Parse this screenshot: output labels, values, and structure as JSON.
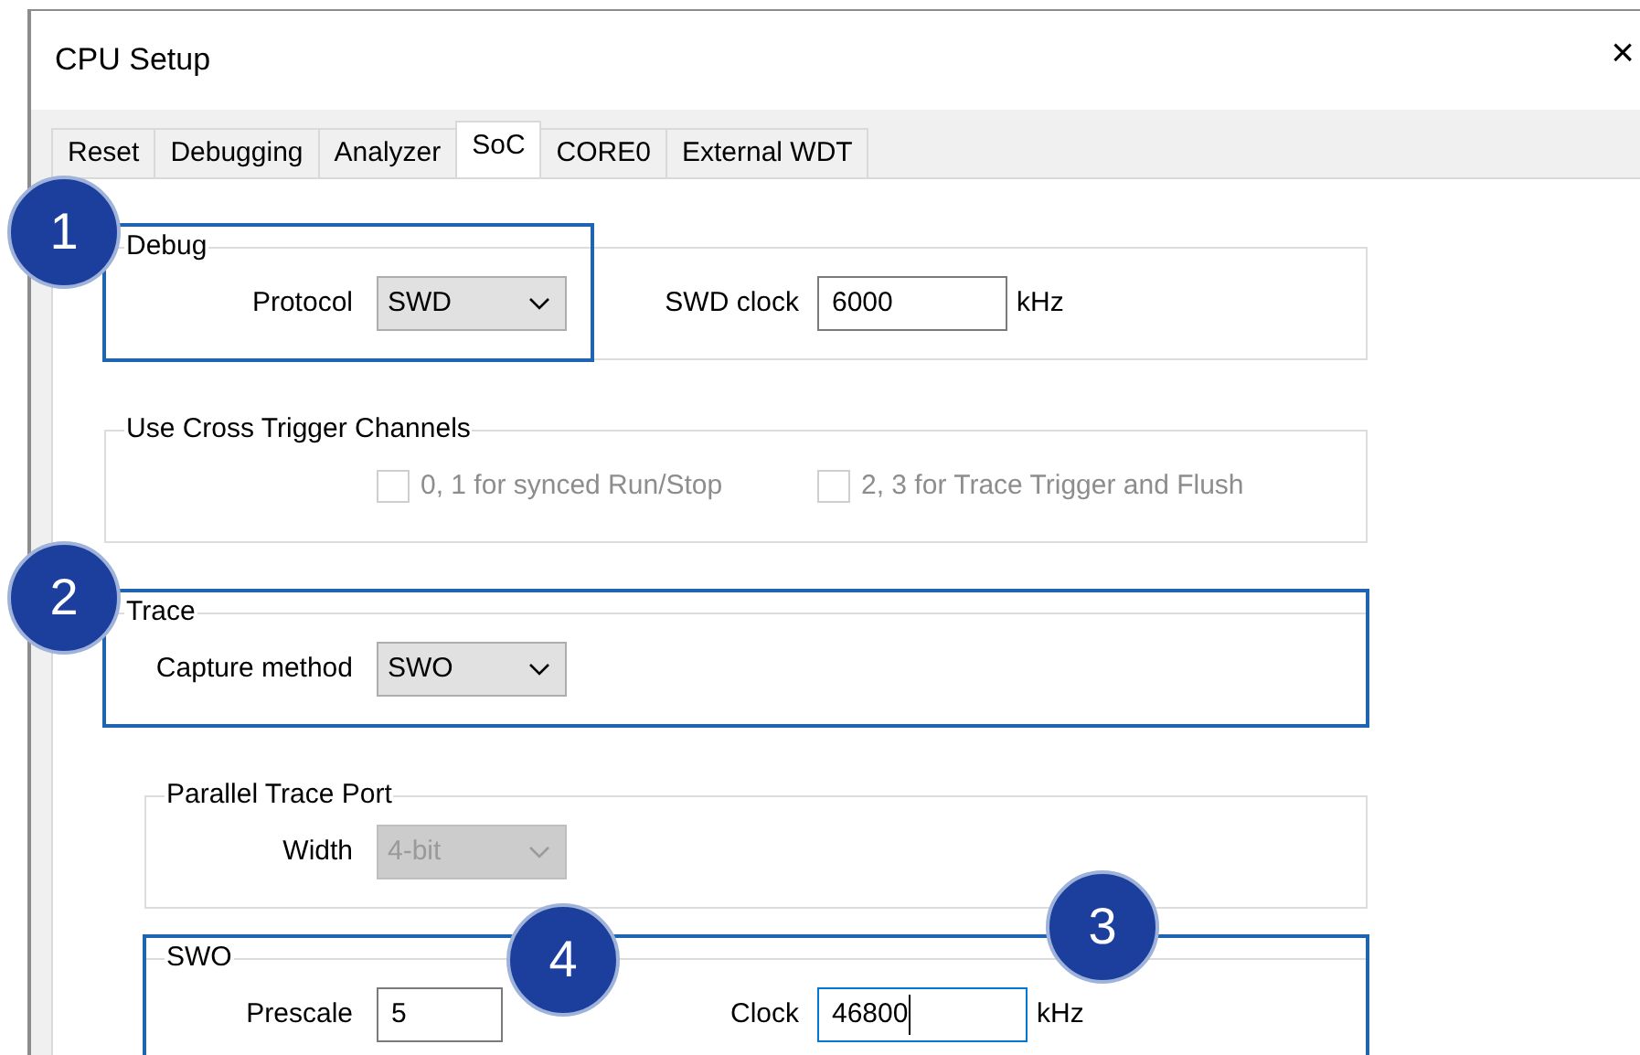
{
  "window": {
    "title": "CPU Setup",
    "close": "×"
  },
  "tabs": [
    {
      "label": "Reset",
      "selected": false
    },
    {
      "label": "Debugging",
      "selected": false
    },
    {
      "label": "Analyzer",
      "selected": false
    },
    {
      "label": "SoC",
      "selected": true
    },
    {
      "label": "CORE0",
      "selected": false
    },
    {
      "label": "External WDT",
      "selected": false
    }
  ],
  "groups": [
    {
      "title": "Debug",
      "callout": "1",
      "fields": [
        {
          "kind": "select",
          "label": "Protocol",
          "value": "SWD",
          "disabled": false,
          "highlighted": true
        },
        {
          "kind": "input",
          "label": "SWD clock",
          "value": "6000",
          "unit": "kHz",
          "focused": false
        }
      ]
    },
    {
      "title": "Use Cross Trigger Channels",
      "fields": [
        {
          "kind": "checkbox",
          "label": "0, 1 for synced Run/Stop",
          "checked": false,
          "disabled": true
        },
        {
          "kind": "checkbox",
          "label": "2, 3 for Trace Trigger and Flush",
          "checked": false,
          "disabled": true
        }
      ]
    },
    {
      "title": "Trace",
      "highlighted": true,
      "callout": "2",
      "fields": [
        {
          "kind": "select",
          "label": "Capture method",
          "value": "SWO",
          "disabled": false
        }
      ],
      "children": [
        {
          "title": "Parallel Trace Port",
          "fields": [
            {
              "kind": "select",
              "label": "Width",
              "value": "4-bit",
              "disabled": true
            }
          ]
        },
        {
          "title": "SWO",
          "highlighted": true,
          "fields": [
            {
              "kind": "input",
              "label": "Prescale",
              "value": "5",
              "focused": false,
              "callout": "4"
            },
            {
              "kind": "input",
              "label": "Clock",
              "value": "46800",
              "unit": "kHz",
              "focused": true,
              "callout": "3"
            }
          ]
        }
      ]
    }
  ]
}
